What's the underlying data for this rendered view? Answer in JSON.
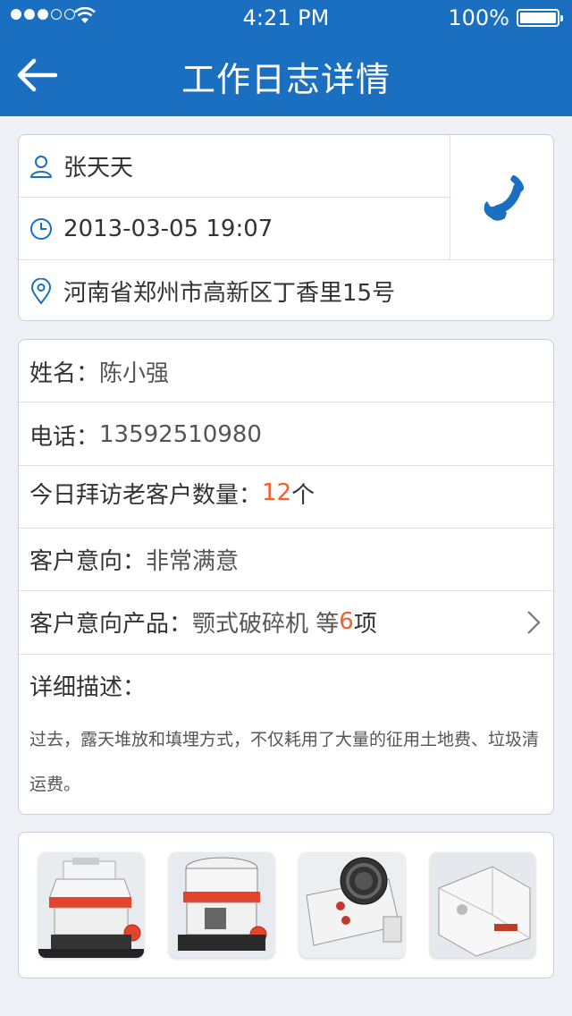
{
  "status_bar": {
    "time": "4:21 PM",
    "battery": "100%"
  },
  "header": {
    "title": "工作日志详情"
  },
  "contact": {
    "name": "张天天",
    "datetime": "2013-03-05 19:07",
    "address": "河南省郑州市高新区丁香里15号"
  },
  "details": {
    "name_label": "姓名：",
    "name_value": "陈小强",
    "phone_label": "电话：",
    "phone_value": "13592510980",
    "visits_label": "今日拜访老客户数量：",
    "visits_count": "12",
    "visits_unit": "个",
    "intent_label": "客户意向：",
    "intent_value": "非常满意",
    "product_label": "客户意向产品：",
    "product_value": "颚式破碎机 等",
    "product_count": "6",
    "product_unit": "项",
    "desc_label": "详细描述：",
    "desc_text": "过去，露天堆放和填埋方式，不仅耗用了大量的征用土地费、垃圾清运费。"
  },
  "colors": {
    "header_bg": "#1a6fc1",
    "accent_orange": "#f0612d",
    "icon_blue": "#1a6fc1"
  },
  "icons": [
    "back-arrow-icon",
    "user-icon",
    "clock-icon",
    "location-icon",
    "phone-icon",
    "chevron-right-icon"
  ],
  "gallery": [
    {
      "name": "cone-crusher-1"
    },
    {
      "name": "cone-crusher-2"
    },
    {
      "name": "jaw-crusher"
    },
    {
      "name": "impact-crusher"
    }
  ]
}
